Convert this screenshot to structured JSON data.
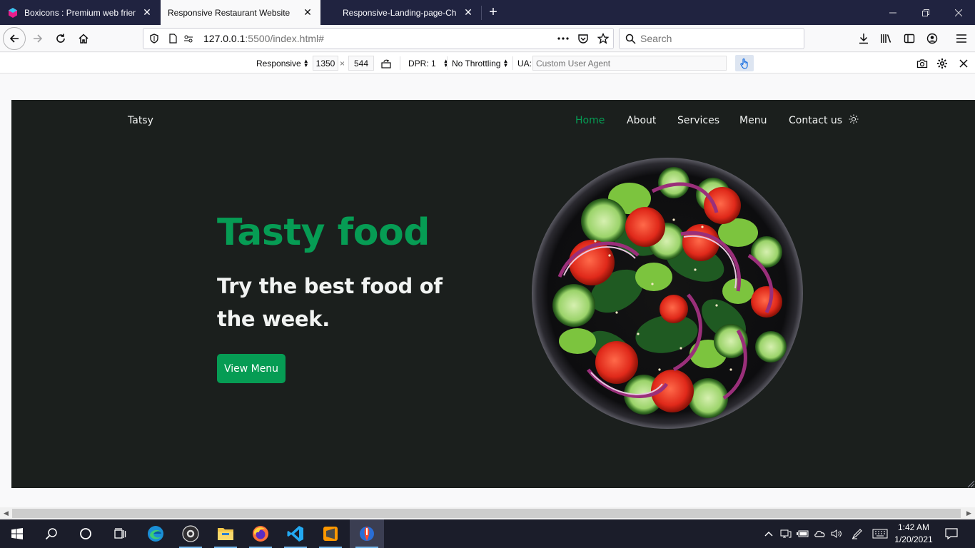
{
  "browser": {
    "tabs": [
      {
        "title": "Boxicons : Premium web friend",
        "active": false
      },
      {
        "title": "Responsive Restaurant Website",
        "active": true
      },
      {
        "title": "Responsive-Landing-page-Chr",
        "active": false
      }
    ],
    "url_host": "127.0.0.1",
    "url_rest": ":5500/index.html#",
    "search_placeholder": "Search"
  },
  "rdm": {
    "device": "Responsive",
    "width": "1350",
    "times": "×",
    "height": "544",
    "dpr": "DPR: 1",
    "throttling": "No Throttling",
    "ua_label": "UA:",
    "ua_placeholder": "Custom User Agent"
  },
  "site": {
    "logo": "Tatsy",
    "nav": [
      "Home",
      "About",
      "Services",
      "Menu",
      "Contact us"
    ],
    "active_nav": "Home",
    "hero_title": "Tasty food",
    "hero_subtitle": "Try the best food of the week.",
    "cta": "View Menu",
    "colors": {
      "accent": "#069c54",
      "background": "#1b1f1d",
      "text": "#f1f3f2"
    }
  },
  "taskbar": {
    "apps": [
      "start-icon",
      "search-icon",
      "cortana-icon",
      "task-view-icon",
      "edge-icon",
      "obs-icon",
      "file-explorer-icon",
      "firefox-icon",
      "vscode-icon",
      "sublime-text-icon",
      "firefox-dev-icon"
    ],
    "time": "1:42 AM",
    "date": "1/20/2021"
  }
}
